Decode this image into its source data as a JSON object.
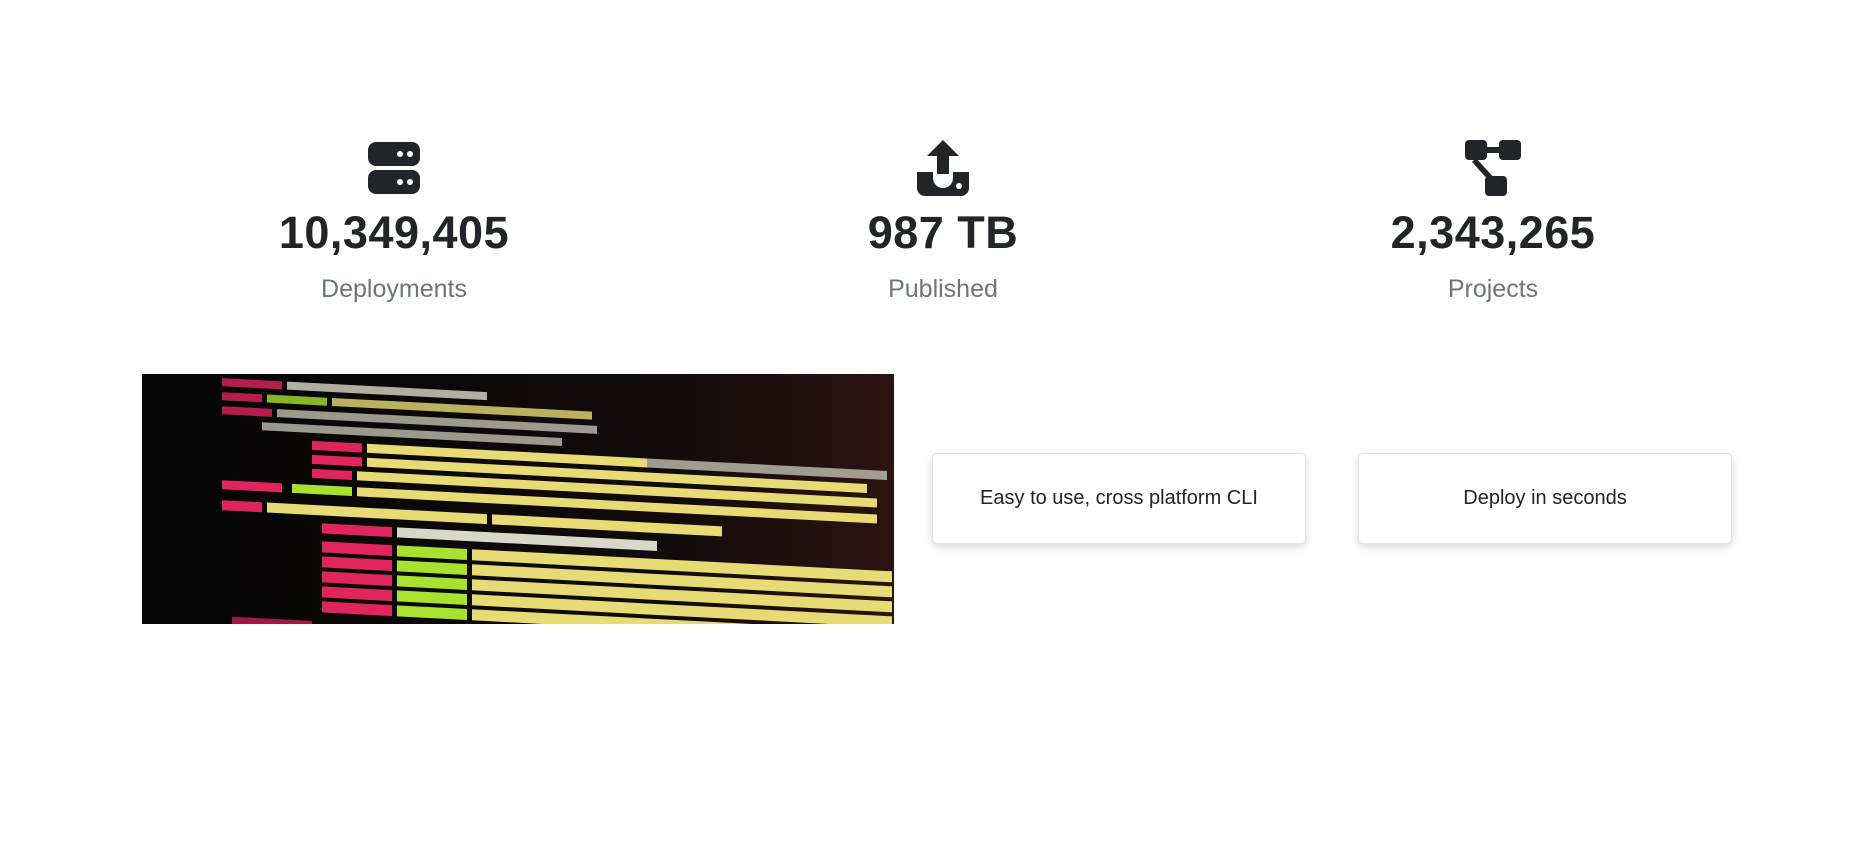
{
  "stats": [
    {
      "icon": "server-icon",
      "value": "10,349,405",
      "label": "Deployments"
    },
    {
      "icon": "upload-icon",
      "value": "987 TB",
      "label": "Published"
    },
    {
      "icon": "diagram-icon",
      "value": "2,343,265",
      "label": "Projects"
    }
  ],
  "image": {
    "description_icon": "code-screenshot-image"
  },
  "cards": [
    {
      "label": "Easy to use, cross platform CLI"
    },
    {
      "label": "Deploy in seconds"
    }
  ],
  "colors": {
    "text": "#212529",
    "muted": "#6c757d",
    "icon": "#212529"
  }
}
